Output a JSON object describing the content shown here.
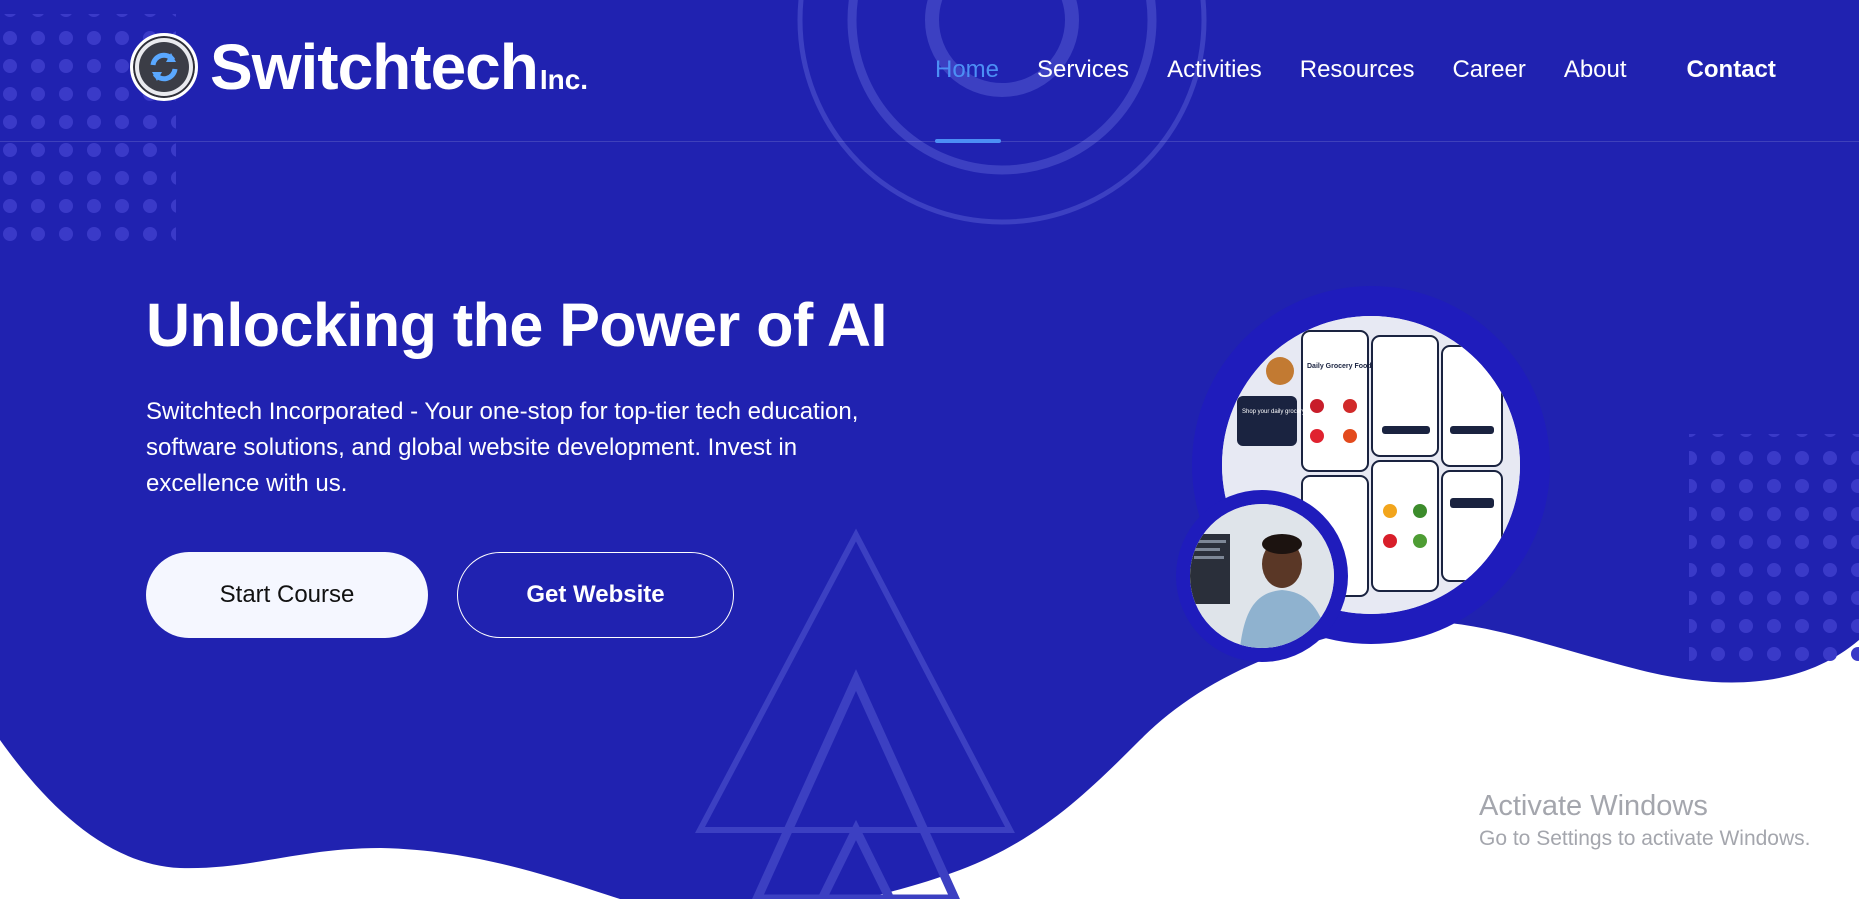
{
  "brand": {
    "name": "Switchtech",
    "suffix": "Inc.",
    "logo_icon": "sync-arrows-icon"
  },
  "nav": {
    "items": [
      {
        "label": "Home",
        "active": true
      },
      {
        "label": "Services",
        "active": false
      },
      {
        "label": "Activities",
        "active": false
      },
      {
        "label": "Resources",
        "active": false
      },
      {
        "label": "Career",
        "active": false
      },
      {
        "label": "About",
        "active": false
      }
    ],
    "contact_label": "Contact"
  },
  "hero": {
    "title": "Unlocking the Power of AI",
    "description": "Switchtech Incorporated - Your one-stop for top-tier tech education, software solutions, and global website development. Invest in excellence with us.",
    "primary_button": "Start Course",
    "secondary_button": "Get Website"
  },
  "mockup": {
    "app_title": "Daily Grocery Food",
    "promo_title": "Shop your daily grocery",
    "screens_icon": "grocery-app-screens-image",
    "photo_icon": "developer-photo-image"
  },
  "watermark": {
    "title": "Activate Windows",
    "subtitle": "Go to Settings to activate Windows."
  },
  "colors": {
    "hero_blue": "#2022b0",
    "accent_blue": "#4c8ff5",
    "white": "#ffffff",
    "button_light": "#f5f7ff"
  }
}
